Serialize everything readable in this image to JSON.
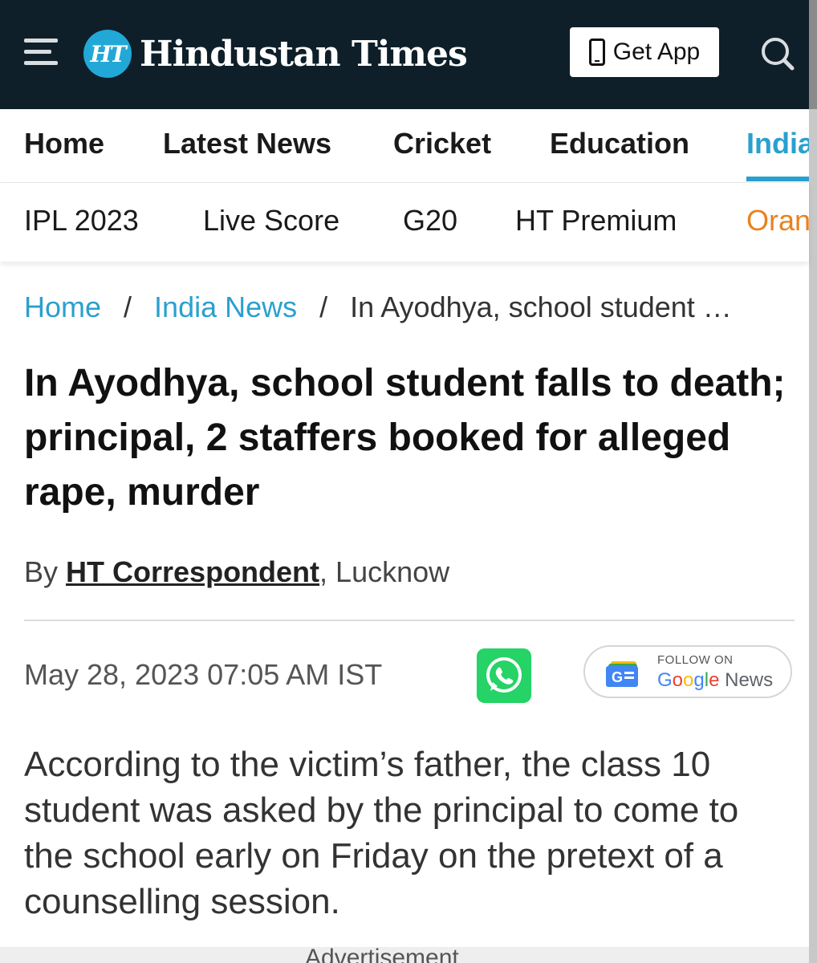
{
  "header": {
    "logo_badge": "HT",
    "logo_text": "Hindustan Times",
    "get_app_label": "Get App",
    "bg_color": "#0e1f2a",
    "accent_color": "#2aa0cf"
  },
  "nav_primary": {
    "items": [
      {
        "label": "Home",
        "active": false
      },
      {
        "label": "Latest News",
        "active": false
      },
      {
        "label": "Cricket",
        "active": false
      },
      {
        "label": "Education",
        "active": false
      },
      {
        "label": "India",
        "active": true
      }
    ]
  },
  "nav_secondary": {
    "items": [
      {
        "label": "IPL 2023"
      },
      {
        "label": "Live Score"
      },
      {
        "label": "G20"
      },
      {
        "label": "HT Premium"
      },
      {
        "label": "Orang"
      }
    ],
    "highlight_color": "#e8821e"
  },
  "breadcrumb": {
    "home": "Home",
    "section": "India News",
    "separator": "/",
    "current": "In Ayodhya, school student …"
  },
  "article": {
    "headline": "In Ayodhya, school student falls to death; principal, 2 staffers booked for alleged rape, murder",
    "byline_prefix": "By",
    "author": "HT Correspondent",
    "location": ", Lucknow",
    "date": "May 28, 2023 07:05 AM IST",
    "summary": "According to the victim’s father, the class 10 student was asked by the principal to come to the school early on Friday on the pretext of a counselling session."
  },
  "follow": {
    "label": "FOLLOW ON",
    "brand_g": "G",
    "brand_o1": "o",
    "brand_o2": "o",
    "brand_g2": "g",
    "brand_l": "l",
    "brand_e": "e",
    "brand_news": " News"
  },
  "ad": {
    "label": "Advertisement"
  },
  "icons": [
    "menu-icon",
    "search-icon",
    "phone-icon",
    "whatsapp-icon",
    "google-news-icon"
  ]
}
